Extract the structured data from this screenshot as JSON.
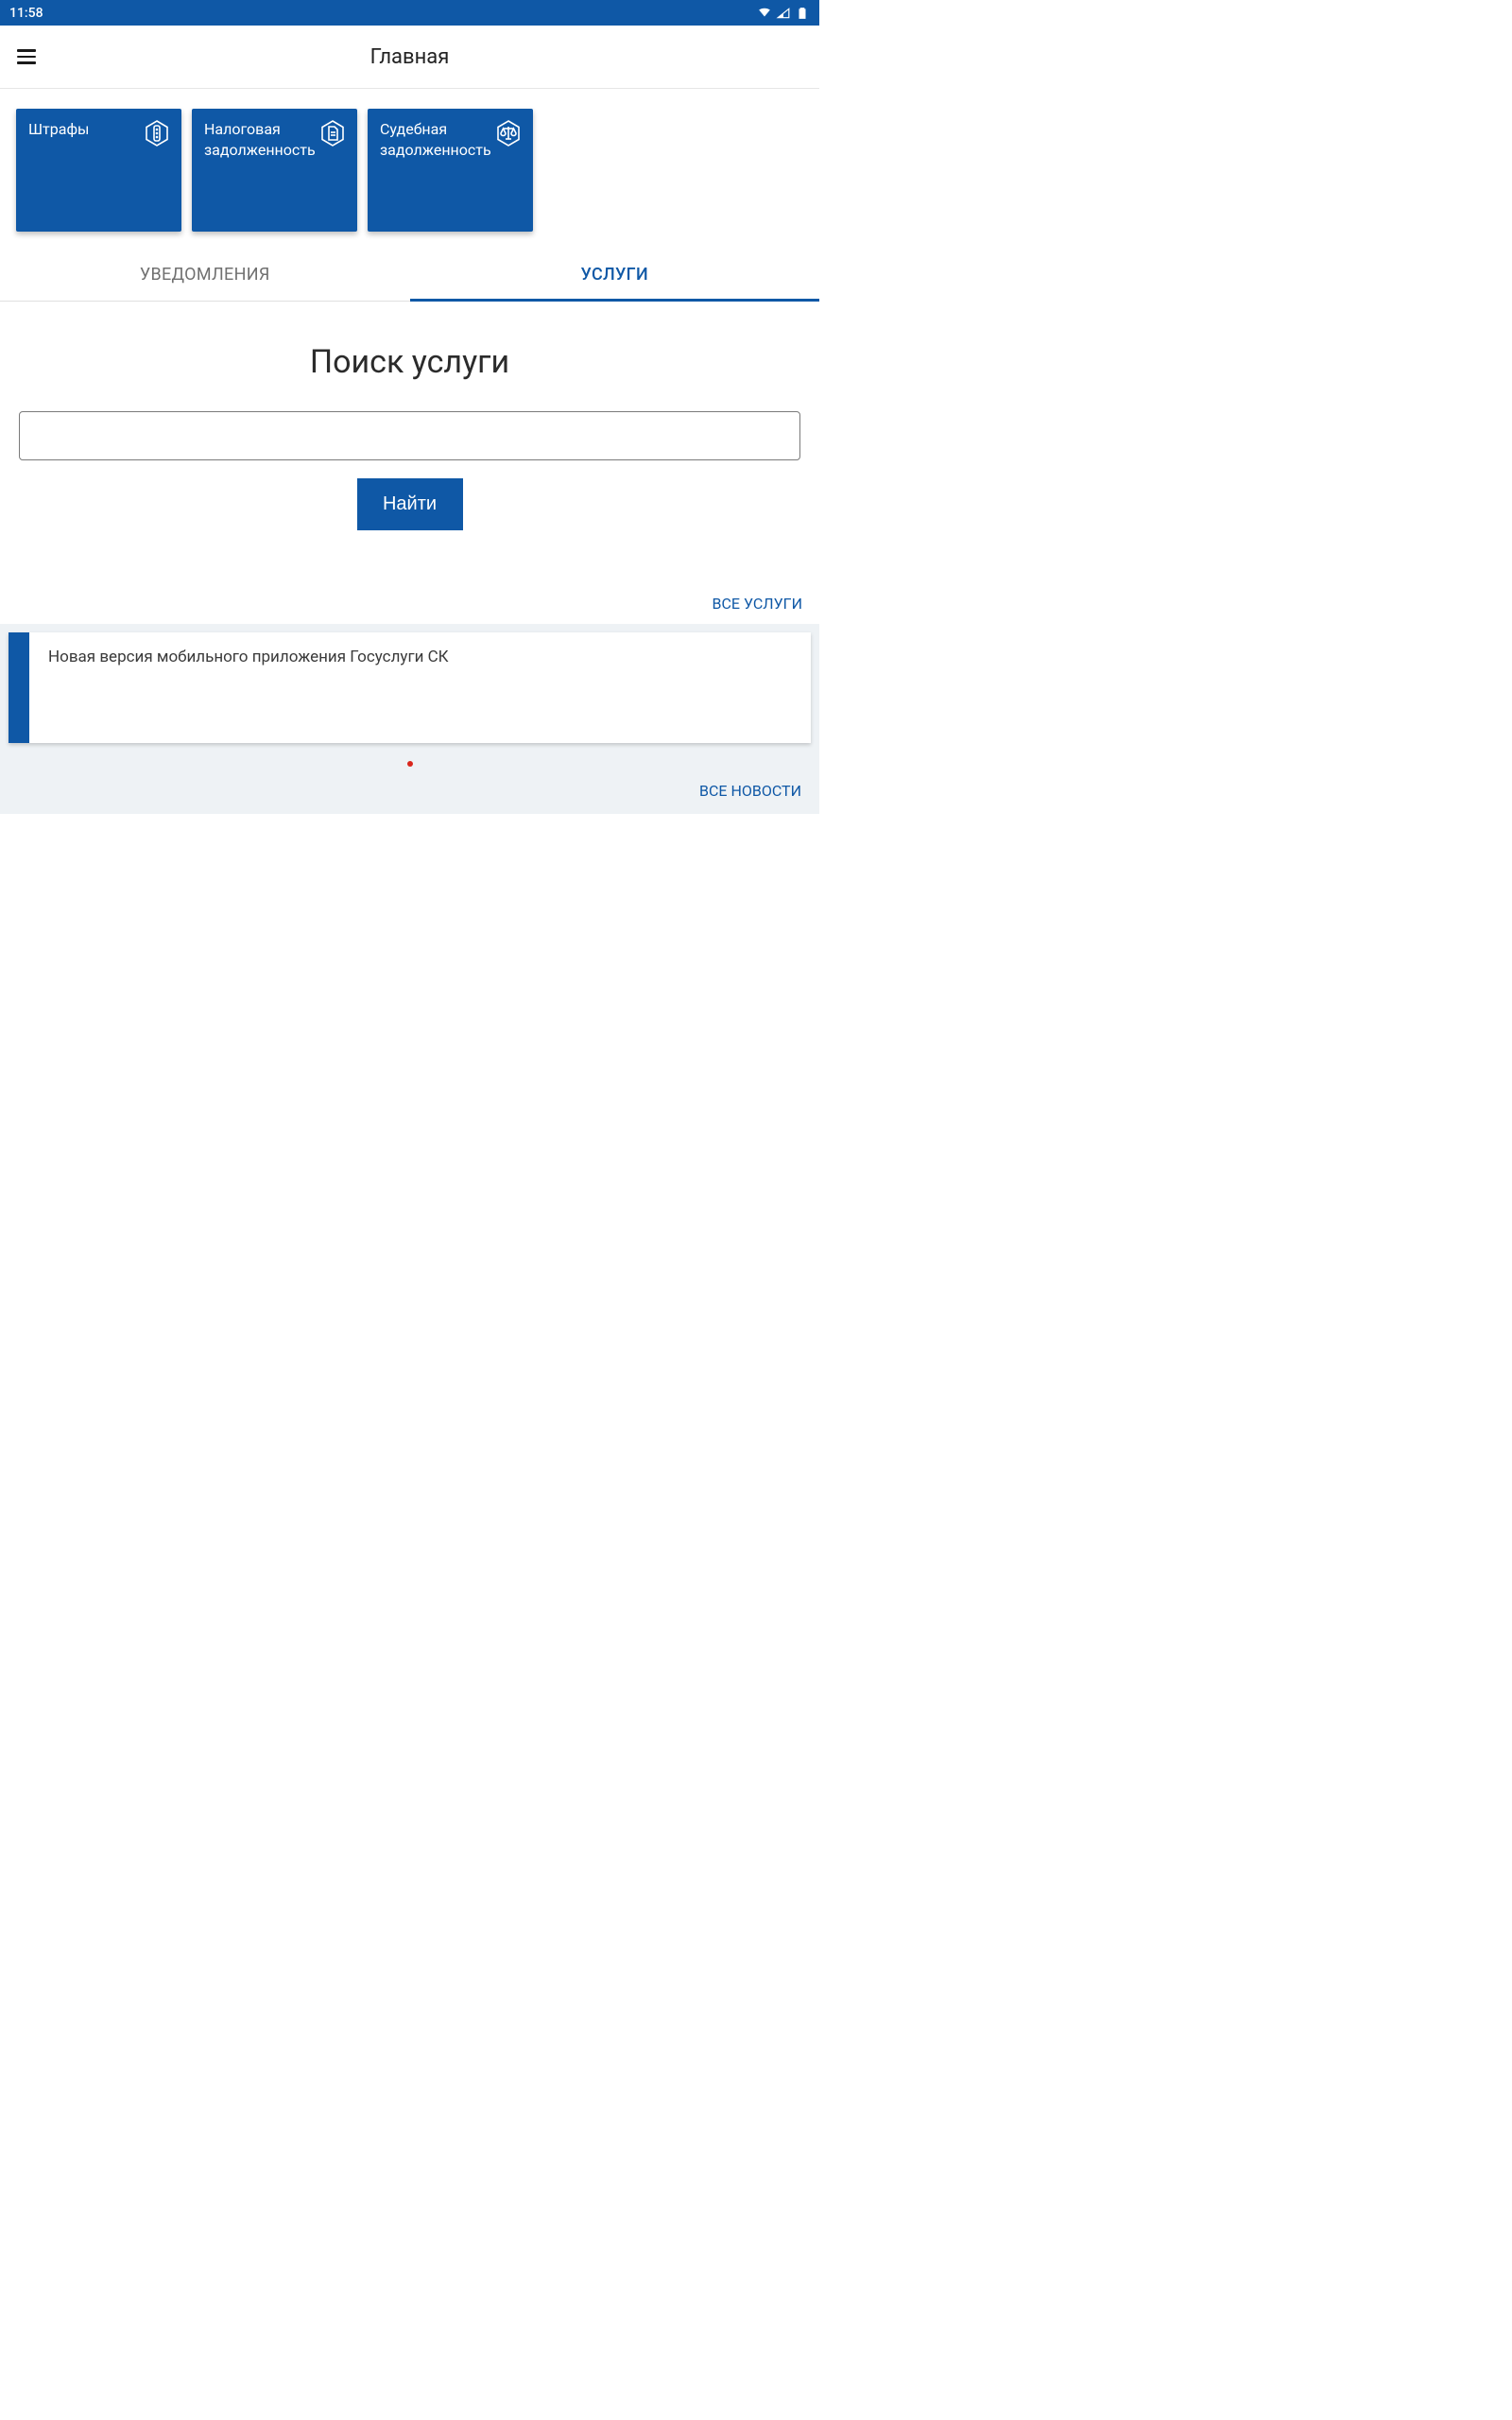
{
  "status": {
    "time": "11:58"
  },
  "header": {
    "title": "Главная"
  },
  "cards": [
    {
      "label": "Штрафы"
    },
    {
      "label": "Налоговая задолженность"
    },
    {
      "label": "Судебная задолженность"
    }
  ],
  "tabs": {
    "notifications": "УВЕДОМЛЕНИЯ",
    "services": "УСЛУГИ"
  },
  "search": {
    "title": "Поиск услуги",
    "value": "",
    "button": "Найти",
    "all_link": "ВСЕ УСЛУГИ"
  },
  "news": {
    "item": "Новая версия мобильного приложения Госуслуги СК",
    "all_link": "ВСЕ НОВОСТИ"
  }
}
